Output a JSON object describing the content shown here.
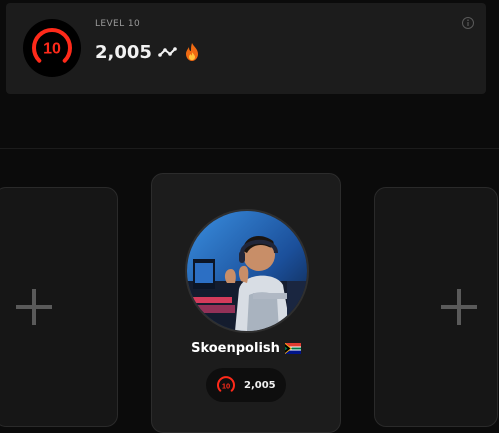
{
  "level_card": {
    "level_label": "LEVEL 10",
    "level_number": "10",
    "elo": "2,005",
    "trend_icon": "trend-line-icon",
    "fire_icon": "fire-icon",
    "info_icon": "info-icon"
  },
  "slots": {
    "left_icon": "plus-icon",
    "right_icon": "plus-icon"
  },
  "player": {
    "nickname": "Skoenpolish",
    "flag_icon": "south-africa-flag-icon",
    "level": "10",
    "elo": "2,005"
  },
  "colors": {
    "background": "#0b0b0b",
    "card": "#1c1c1c",
    "level_red": "#ff2a1a",
    "muted": "#9a9a9a"
  }
}
